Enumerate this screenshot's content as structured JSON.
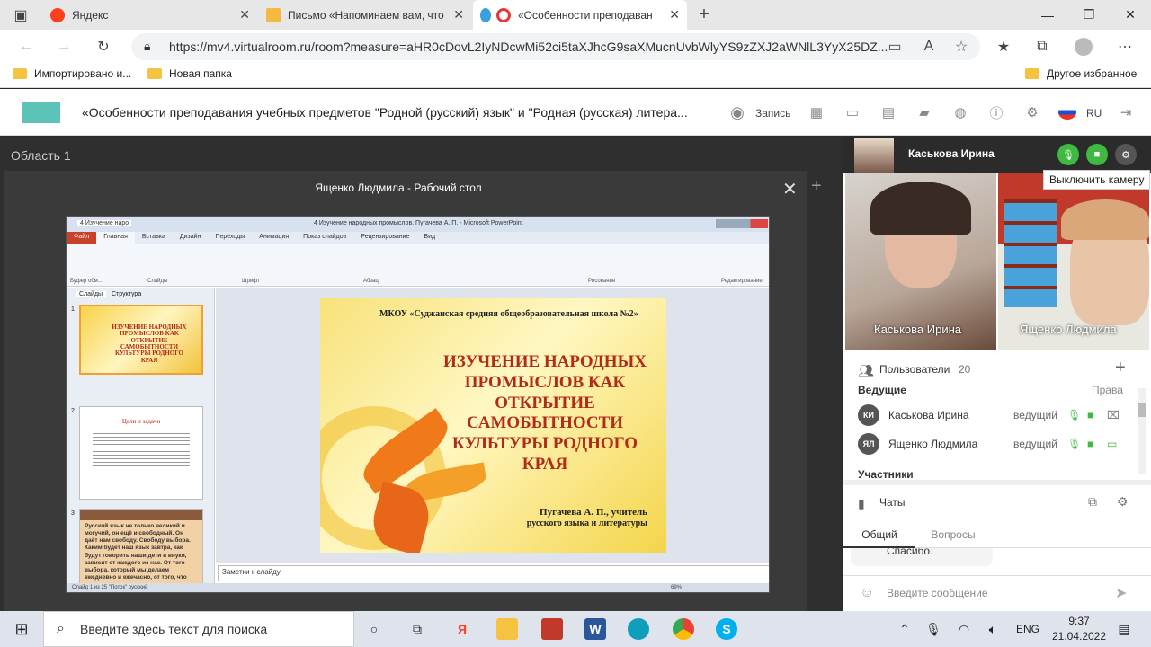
{
  "browser": {
    "tabs": [
      {
        "label": "Яндекс",
        "color": "#fc3f1d"
      },
      {
        "label": "Письмо «Напоминаем вам, что",
        "color": "#f5b942"
      },
      {
        "label": "«Особенности преподаван",
        "color": "#e53935"
      }
    ],
    "url": "https://mv4.virtualroom.ru/room?measure=aHR0cDovL2IyNDcwMi52ci5taXJhcG9saXMucnUvbWlyYS9zZXJ2aWNlL3YyX25DZ...",
    "bookmarks": [
      "Импортировано и...",
      "Новая папка"
    ],
    "other_bookmarks": "Другое избранное"
  },
  "app": {
    "title": "«Особенности преподавания учебных предметов \"Родной (русский) язык\" и \"Родная (русская) литера...",
    "record_label": "Запись",
    "lang": "RU"
  },
  "stage": {
    "area_title": "Область 1",
    "share_title": "Ященко Людмила - Рабочий стол"
  },
  "ppt": {
    "window_title": "4 Изучение народных промыслов. Пугачева А. П. - Microsoft PowerPoint",
    "tab_title": "4 Изучение наро",
    "menu": [
      "Файл",
      "Главная",
      "Вставка",
      "Дизайн",
      "Переходы",
      "Анимация",
      "Показ слайдов",
      "Рецензирование",
      "Вид"
    ],
    "ribbon_groups": [
      "Буфер обм...",
      "Слайды",
      "Шрифт",
      "Абзац",
      "Рисование",
      "Редактирование"
    ],
    "panel_tabs": [
      "Слайды",
      "Структура"
    ],
    "school": "МКОУ «Суджанская средняя общеобразовательная школа №2»",
    "slide_title": "ИЗУЧЕНИЕ НАРОДНЫХ ПРОМЫСЛОВ КАК ОТКРЫТИЕ САМОБЫТНОСТИ КУЛЬТУРЫ РОДНОГО КРАЯ",
    "author_line1": "Пугачева А. П., учитель",
    "author_line2": "русского языка и литературы",
    "thumb2_title": "Цели и задачи",
    "thumb3_text": "Русский язык не только великий и могучий, он ещё и свободный. Он даёт нам свободу. Свободу выбора. Каким будет наш язык завтра, как будут говорить наши дети и внуки, зависит от каждого из нас. От того выбора, который мы делаем ежедневно и ежечасно, от того, что",
    "notes": "Заметки к слайду",
    "status": "Слайд 1 из 25   \"Поток\"   русский",
    "zoom": "69%"
  },
  "right_panel": {
    "presenter": "Каськова Ирина",
    "tooltip": "Выключить камеру",
    "videos": [
      "Каськова Ирина",
      "Ященко Людмила"
    ],
    "users_label": "Пользователи",
    "users_count": "20",
    "hosts_label": "Ведущие",
    "rights_label": "Права",
    "hosts": [
      {
        "initials": "КИ",
        "name": "Каськова Ирина",
        "role": "ведущий"
      },
      {
        "initials": "ЯЛ",
        "name": "Ященко Людмила",
        "role": "ведущий"
      }
    ],
    "participants_label": "Участники",
    "chats_label": "Чаты",
    "chat_tabs": [
      "Общий",
      "Вопросы"
    ],
    "last_message": "Спасибо.",
    "message_placeholder": "Введите сообщение"
  },
  "taskbar": {
    "search_placeholder": "Введите здесь текст для поиска",
    "lang": "ENG",
    "time": "9:37",
    "date": "21.04.2022"
  },
  "colors": {
    "green": "#3fb93f",
    "accent": "#5cc3b8",
    "ppt_red": "#c9412a"
  }
}
